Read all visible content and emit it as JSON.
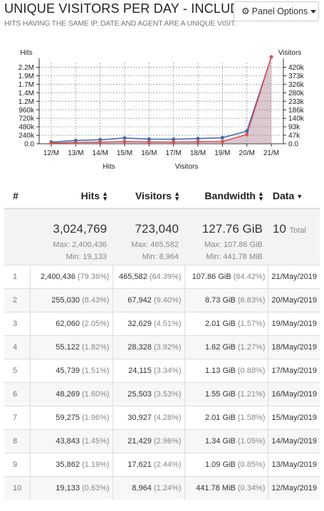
{
  "header": {
    "title": "UNIQUE VISITORS PER DAY - INCLUDING",
    "subtitle": "HITS HAVING THE SAME IP, DATE AND AGENT ARE A UNIQUE VISIT.",
    "panel_button": "Panel Options",
    "panel_icon": "gear-icon"
  },
  "chart_data": {
    "type": "area",
    "x": [
      "12/M",
      "13/M",
      "14/M",
      "15/M",
      "16/M",
      "17/M",
      "18/M",
      "19/M",
      "20/M",
      "21/M"
    ],
    "series": [
      {
        "name": "Hits",
        "axis": "left",
        "color": "#d9534f",
        "values": [
          19133,
          35862,
          43843,
          59275,
          48269,
          45739,
          55122,
          62060,
          255030,
          2400436
        ]
      },
      {
        "name": "Visitors",
        "axis": "right",
        "color": "#3d6cb0",
        "values": [
          8964,
          17621,
          21429,
          30927,
          25503,
          24115,
          28328,
          32629,
          67942,
          465582
        ]
      }
    ],
    "left_axis": {
      "label": "Hits",
      "ticks": [
        "0.0",
        "240k",
        "480k",
        "720k",
        "960k",
        "1.2M",
        "1.4M",
        "1.7M",
        "1.9M",
        "2.2M"
      ],
      "max": 2400436
    },
    "right_axis": {
      "label": "Visitors",
      "ticks": [
        "0.0",
        "47k",
        "93k",
        "140k",
        "186k",
        "233k",
        "280k",
        "326k",
        "373k",
        "420k"
      ],
      "max": 465582
    },
    "legend": [
      "Hits",
      "Visitors"
    ],
    "grid": true
  },
  "table": {
    "headers": {
      "num": "#",
      "hits": "Hits",
      "visitors": "Visitors",
      "bandwidth": "Bandwidth",
      "data": "Data"
    },
    "summary": {
      "hits": "3,024,769",
      "hits_max": "Max: 2,400,436",
      "hits_min": "Min: 19,133",
      "visitors": "723,040",
      "visitors_max": "Max: 465,582",
      "visitors_min": "Min: 8,964",
      "bandwidth": "127.76 GiB",
      "bandwidth_max": "Max: 107.86 GiB",
      "bandwidth_min": "Min: 441.78 MiB",
      "data_total": "10",
      "data_total_label": "Total"
    },
    "rows": [
      {
        "num": "1",
        "hits": "2,400,436",
        "hits_pct": "(79.36%)",
        "visitors": "465,582",
        "visitors_pct": "(64.39%)",
        "bw": "107.86 GiB",
        "bw_pct": "(84.42%)",
        "date": "21/May/2019"
      },
      {
        "num": "2",
        "hits": "255,030",
        "hits_pct": "(8.43%)",
        "visitors": "67,942",
        "visitors_pct": "(9.40%)",
        "bw": "8.73 GiB",
        "bw_pct": "(6.83%)",
        "date": "20/May/2019"
      },
      {
        "num": "3",
        "hits": "62,060",
        "hits_pct": "(2.05%)",
        "visitors": "32,629",
        "visitors_pct": "(4.51%)",
        "bw": "2.01 GiB",
        "bw_pct": "(1.57%)",
        "date": "19/May/2019"
      },
      {
        "num": "4",
        "hits": "55,122",
        "hits_pct": "(1.82%)",
        "visitors": "28,328",
        "visitors_pct": "(3.92%)",
        "bw": "1.62 GiB",
        "bw_pct": "(1.27%)",
        "date": "18/May/2019"
      },
      {
        "num": "5",
        "hits": "45,739",
        "hits_pct": "(1.51%)",
        "visitors": "24,115",
        "visitors_pct": "(3.34%)",
        "bw": "1.13 GiB",
        "bw_pct": "(0.88%)",
        "date": "17/May/2019"
      },
      {
        "num": "6",
        "hits": "48,269",
        "hits_pct": "(1.60%)",
        "visitors": "25,503",
        "visitors_pct": "(3.53%)",
        "bw": "1.55 GiB",
        "bw_pct": "(1.21%)",
        "date": "16/May/2019"
      },
      {
        "num": "7",
        "hits": "59,275",
        "hits_pct": "(1.96%)",
        "visitors": "30,927",
        "visitors_pct": "(4.28%)",
        "bw": "2.01 GiB",
        "bw_pct": "(1.58%)",
        "date": "15/May/2019"
      },
      {
        "num": "8",
        "hits": "43,843",
        "hits_pct": "(1.45%)",
        "visitors": "21,429",
        "visitors_pct": "(2.96%)",
        "bw": "1.34 GiB",
        "bw_pct": "(1.05%)",
        "date": "14/May/2019"
      },
      {
        "num": "9",
        "hits": "35,862",
        "hits_pct": "(1.19%)",
        "visitors": "17,621",
        "visitors_pct": "(2.44%)",
        "bw": "1.09 GiB",
        "bw_pct": "(0.85%)",
        "date": "13/May/2019"
      },
      {
        "num": "10",
        "hits": "19,133",
        "hits_pct": "(0.63%)",
        "visitors": "8,964",
        "visitors_pct": "(1.24%)",
        "bw": "441.78 MiB",
        "bw_pct": "(0.34%)",
        "date": "12/May/2019"
      }
    ]
  }
}
